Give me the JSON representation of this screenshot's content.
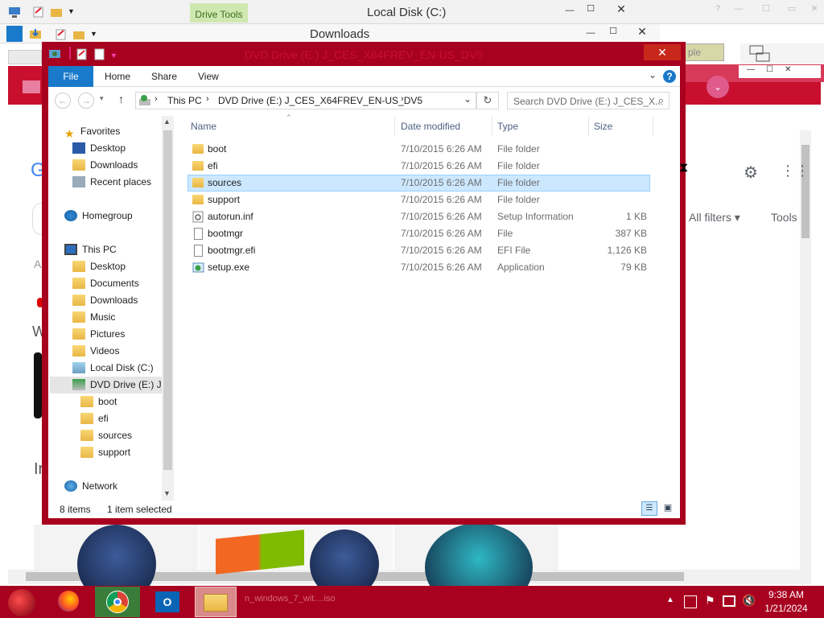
{
  "bg_windows": {
    "drive_tools_label": "Drive Tools",
    "top_title": "Local Disk (C:)",
    "second_title": "Downloads",
    "ghost_text": "ple"
  },
  "explorer": {
    "title": "DVD Drive (E:) J_CES_X64FREV_EN-US_DV5",
    "ribbon_tabs": {
      "file": "File",
      "home": "Home",
      "share": "Share",
      "view": "View"
    },
    "breadcrumb": [
      "This PC",
      "DVD Drive (E:) J_CES_X64FREV_EN-US_DV5"
    ],
    "search_placeholder": "Search DVD Drive (E:) J_CES_X...",
    "nav": {
      "favorites": "Favorites",
      "desktop": "Desktop",
      "downloads": "Downloads",
      "recent_places": "Recent places",
      "homegroup": "Homegroup",
      "this_pc": "This PC",
      "pc_desktop": "Desktop",
      "documents": "Documents",
      "pc_downloads": "Downloads",
      "music": "Music",
      "pictures": "Pictures",
      "videos": "Videos",
      "local_disk": "Local Disk (C:)",
      "dvd_drive": "DVD Drive (E:) J_C",
      "sub_boot": "boot",
      "sub_efi": "efi",
      "sub_sources": "sources",
      "sub_support": "support",
      "network": "Network"
    },
    "columns": {
      "name": "Name",
      "date": "Date modified",
      "type": "Type",
      "size": "Size"
    },
    "files": [
      {
        "name": "boot",
        "date": "7/10/2015 6:26 AM",
        "type": "File folder",
        "size": "",
        "icon": "folder-icon"
      },
      {
        "name": "efi",
        "date": "7/10/2015 6:26 AM",
        "type": "File folder",
        "size": "",
        "icon": "folder-icon"
      },
      {
        "name": "sources",
        "date": "7/10/2015 6:26 AM",
        "type": "File folder",
        "size": "",
        "icon": "folder-icon",
        "selected": true
      },
      {
        "name": "support",
        "date": "7/10/2015 6:26 AM",
        "type": "File folder",
        "size": "",
        "icon": "folder-icon"
      },
      {
        "name": "autorun.inf",
        "date": "7/10/2015 6:26 AM",
        "type": "Setup Information",
        "size": "1 KB",
        "icon": "settings-file-icon"
      },
      {
        "name": "bootmgr",
        "date": "7/10/2015 6:26 AM",
        "type": "File",
        "size": "387 KB",
        "icon": "file-icon"
      },
      {
        "name": "bootmgr.efi",
        "date": "7/10/2015 6:26 AM",
        "type": "EFI File",
        "size": "1,126 KB",
        "icon": "file-icon"
      },
      {
        "name": "setup.exe",
        "date": "7/10/2015 6:26 AM",
        "type": "Application",
        "size": "79 KB",
        "icon": "setup-app-icon"
      }
    ],
    "status": {
      "count": "8 items",
      "selected": "1 item selected"
    }
  },
  "browser_behind": {
    "all_filters": "All filters",
    "tools": "Tools"
  },
  "taskbar": {
    "time": "9:38 AM",
    "date": "1/21/2024",
    "ghost_text": "n_windows_7_wit....iso"
  }
}
